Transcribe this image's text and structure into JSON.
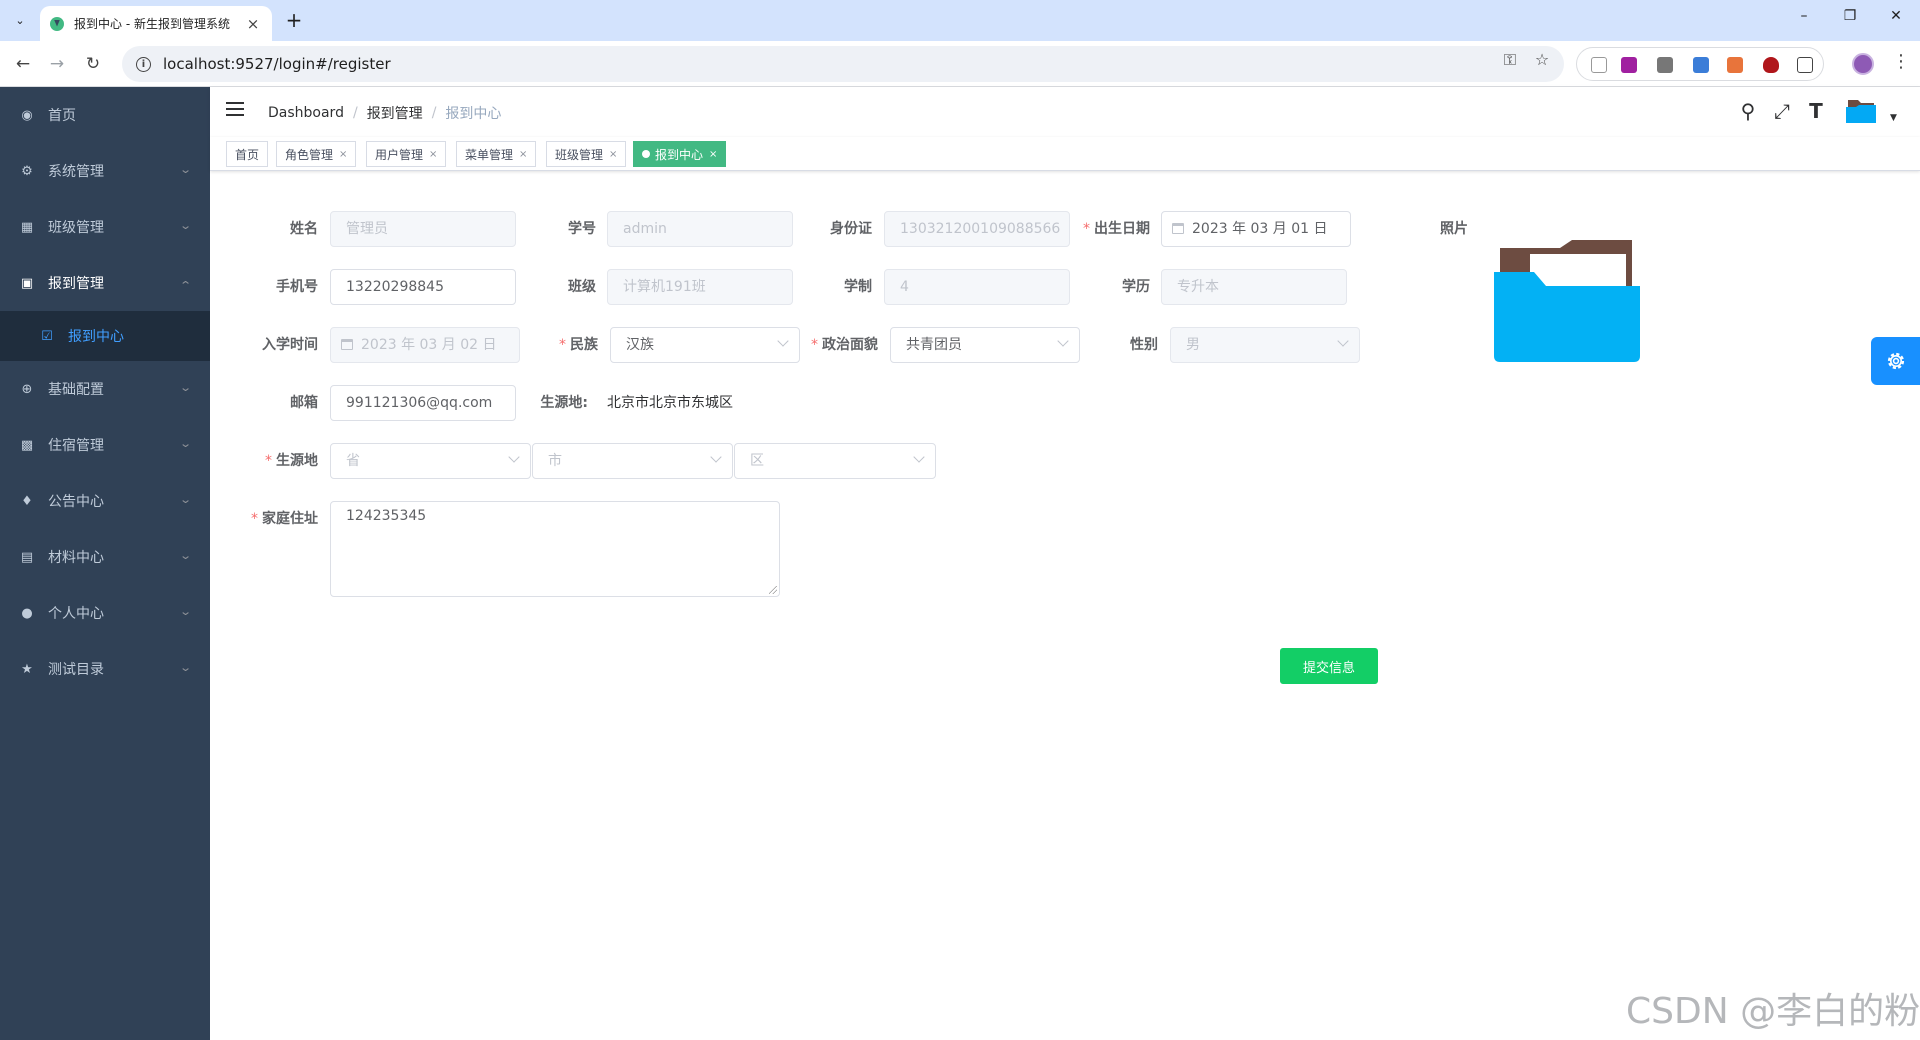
{
  "browser": {
    "tab_title": "报到中心 - 新生报到管理系统",
    "url": "localhost:9527/login#/register"
  },
  "sidebar": {
    "items": [
      {
        "label": "首页",
        "icon": "dashboard-icon"
      },
      {
        "label": "系统管理",
        "icon": "gear-icon"
      },
      {
        "label": "班级管理",
        "icon": "grid-icon"
      },
      {
        "label": "报到管理",
        "icon": "monitor-icon"
      },
      {
        "label": "基础配置",
        "icon": "plus-circle-icon"
      },
      {
        "label": "住宿管理",
        "icon": "bar-chart-icon"
      },
      {
        "label": "公告中心",
        "icon": "bell-icon"
      },
      {
        "label": "材料中心",
        "icon": "clipboard-icon"
      },
      {
        "label": "个人中心",
        "icon": "user-icon"
      },
      {
        "label": "测试目录",
        "icon": "star-icon"
      }
    ],
    "active_subitem": {
      "label": "报到中心",
      "icon": "checklist-icon"
    }
  },
  "breadcrumb": {
    "root": "Dashboard",
    "parent": "报到管理",
    "current": "报到中心"
  },
  "tags": [
    {
      "label": "首页",
      "closable": false,
      "active": false
    },
    {
      "label": "角色管理",
      "closable": true,
      "active": false
    },
    {
      "label": "用户管理",
      "closable": true,
      "active": false
    },
    {
      "label": "菜单管理",
      "closable": true,
      "active": false
    },
    {
      "label": "班级管理",
      "closable": true,
      "active": false
    },
    {
      "label": "报到中心",
      "closable": true,
      "active": true
    }
  ],
  "form": {
    "name": {
      "label": "姓名",
      "value": "管理员"
    },
    "student_id": {
      "label": "学号",
      "value": "admin"
    },
    "id_card": {
      "label": "身份证",
      "value": "130321200109088566"
    },
    "birth_date": {
      "label": "出生日期",
      "value": "2023 年 03 月 01 日"
    },
    "photo": {
      "label": "照片"
    },
    "phone": {
      "label": "手机号",
      "value": "13220298845"
    },
    "class": {
      "label": "班级",
      "value": "计算机191班"
    },
    "school_years": {
      "label": "学制",
      "value": "4"
    },
    "education": {
      "label": "学历",
      "value": "专升本"
    },
    "enroll_date": {
      "label": "入学时间",
      "value": "2023 年 03 月 02 日"
    },
    "ethnicity": {
      "label": "民族",
      "value": "汉族"
    },
    "political_status": {
      "label": "政治面貌",
      "value": "共青团员"
    },
    "gender": {
      "label": "性别",
      "value": "男"
    },
    "email": {
      "label": "邮箱",
      "value": "991121306@qq.com"
    },
    "origin_display": {
      "label": "生源地:",
      "value": "北京市北京市东城区"
    },
    "origin": {
      "label": "生源地",
      "province_placeholder": "省",
      "city_placeholder": "市",
      "district_placeholder": "区"
    },
    "address": {
      "label": "家庭住址",
      "value": "124235345"
    },
    "submit_label": "提交信息"
  },
  "watermark": "CSDN @李白的粉",
  "colors": {
    "sidebar_bg": "#304156",
    "active_tag": "#42b983",
    "submit": "#13ce66",
    "settings_fab": "#1890ff",
    "link": "#409eff"
  }
}
